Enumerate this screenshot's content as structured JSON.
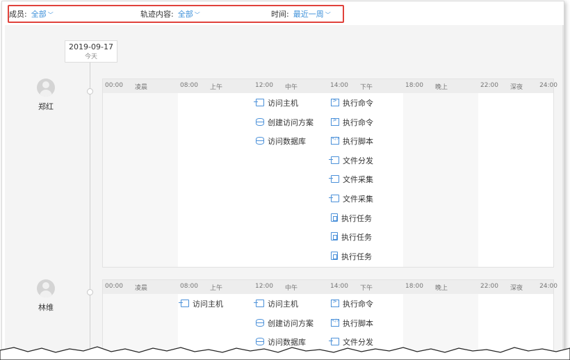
{
  "filters": {
    "member": {
      "label": "成员:",
      "value": "全部"
    },
    "content": {
      "label": "轨迹内容:",
      "value": "全部"
    },
    "time": {
      "label": "时间:",
      "value": "最近一周"
    }
  },
  "date": {
    "value": "2019-09-17",
    "sub": "今天"
  },
  "timeline_header": {
    "times": [
      "00:00",
      "08:00",
      "12:00",
      "14:00",
      "18:00",
      "22:00"
    ],
    "periods": [
      "凌晨",
      "上午",
      "中午",
      "下午",
      "晚上",
      "深夜"
    ],
    "end_time": "24:00"
  },
  "members": [
    {
      "name": "郑红",
      "columns": [
        [],
        [],
        [
          {
            "icon": "monitor-icon",
            "label": "访问主机"
          },
          {
            "icon": "database-icon",
            "label": "创建访问方案"
          },
          {
            "icon": "database-icon",
            "label": "访问数据库"
          }
        ],
        [
          {
            "icon": "terminal-icon",
            "label": "执行命令"
          },
          {
            "icon": "terminal-icon",
            "label": "执行命令"
          },
          {
            "icon": "code-icon",
            "label": "执行脚本"
          },
          {
            "icon": "monitor-icon",
            "label": "文件分发"
          },
          {
            "icon": "monitor-icon",
            "label": "文件采集"
          },
          {
            "icon": "monitor-icon",
            "label": "文件采集"
          },
          {
            "icon": "task-icon",
            "label": "执行任务"
          },
          {
            "icon": "task-icon",
            "label": "执行任务"
          },
          {
            "icon": "task-icon",
            "label": "执行任务"
          }
        ],
        [],
        []
      ]
    },
    {
      "name": "林维",
      "columns": [
        [],
        [
          {
            "icon": "monitor-icon",
            "label": "访问主机"
          }
        ],
        [
          {
            "icon": "monitor-icon",
            "label": "访问主机"
          },
          {
            "icon": "database-icon",
            "label": "创建访问方案"
          },
          {
            "icon": "database-icon",
            "label": "访问数据库"
          }
        ],
        [
          {
            "icon": "terminal-icon",
            "label": "执行命令"
          },
          {
            "icon": "code-icon",
            "label": "执行脚本"
          },
          {
            "icon": "monitor-icon",
            "label": "文件分发"
          }
        ],
        [],
        []
      ]
    }
  ]
}
